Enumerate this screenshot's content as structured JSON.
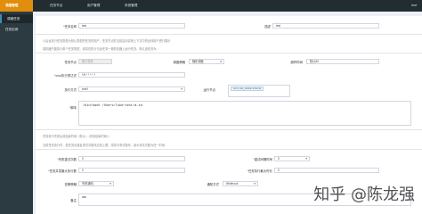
{
  "topbar": {
    "logo": "调度管理",
    "nav": [
      "任务节点",
      "用户管理",
      "系统管理"
    ],
    "user": "test"
  },
  "sidebar": {
    "items": [
      "调度任务",
      "任务实例"
    ]
  },
  "basic": {
    "task_name_label": "任务名称",
    "task_name_value": "test",
    "remark_label": "描述",
    "remark_value": "test"
  },
  "hints": {
    "line1": "以后台执行任务类型为默认类型的任务的用户、任务节点的当前启动实例上下文中的全体用户进行展示",
    "line2": "若机器只能执行单个任务类型，则将仅执行与此任务一致的机器上运行任务，默认该任务为...",
    "line3": "任务执行完成后将结束时间（默认=（有效结束时间））",
    "line4": "当前任务执行时，若任务出错且重试次数未达到上限，将执行重试操作，最大重试次数为任一时间"
  },
  "exec": {
    "node_label": "任务节点",
    "node_value": "执行任务",
    "strategy_label": "调度策略",
    "strategy_value": "随机调度",
    "timeout_label": "超时时间",
    "timeout_value": "默认60",
    "cron_label": "cron执行表达式",
    "cron_value": "*/5 * * * * ?",
    "mode_label": "执行方式",
    "mode_value": "shell",
    "env_label": "运行节点",
    "env_tag": "test | test_docker.internal"
  },
  "script": {
    "label": "脚本",
    "content": "/bin/bash /Users/luke/test/a.sh"
  },
  "retry": {
    "fail_retry_label": "失败重试次数",
    "fail_retry_value": "0",
    "retry_interval_label": "重试间隔时间",
    "retry_interval_value": "0",
    "alarm_label": "告警策略",
    "alarm_value": "失败通知",
    "channel_label": "通知方式",
    "channel_value": "Webhook",
    "max_concurrent_label": "任务并发最大执行数",
    "max_concurrent_value": "0",
    "max_time_label": "任务执行最大时长",
    "max_time_value": "0",
    "note_label": "备注",
    "note_value": "abc"
  },
  "watermark": "知乎 @陈龙强"
}
